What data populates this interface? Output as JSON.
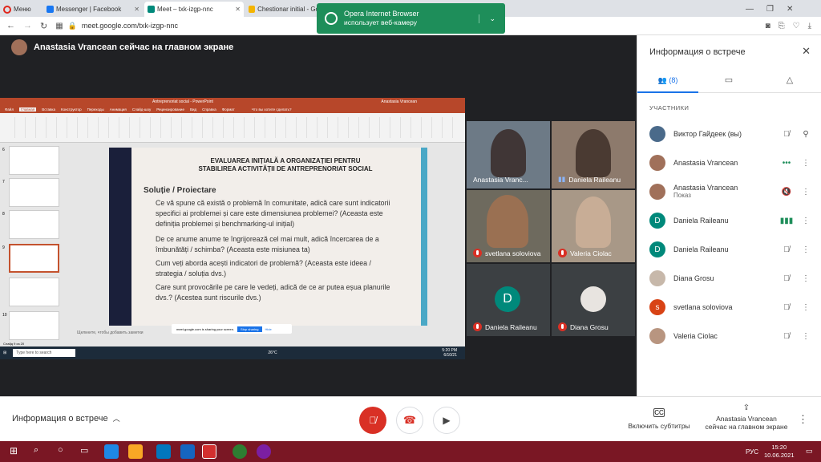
{
  "browser": {
    "menu_label": "Меню",
    "tabs": [
      {
        "label": "Messenger | Facebook",
        "color": "#1877f2"
      },
      {
        "label": "Meet – txk-izgp-nnc",
        "color": "#00897b"
      },
      {
        "label": "Chestionar initial - Go",
        "color": "#f4b400"
      }
    ],
    "url": "meet.google.com/txk-izgp-nnc"
  },
  "toast": {
    "title": "Opera Internet Browser",
    "subtitle": "использует веб-камеру"
  },
  "meet": {
    "presenter_banner": "Anastasia Vrancean сейчас на главном экране",
    "tiles": [
      {
        "name": "Anastasia Vranc...",
        "muted": false,
        "bg": "#6d7a86"
      },
      {
        "name": "Daniela Raileanu",
        "muted": false,
        "bg": "#8d7a6c"
      },
      {
        "name": "svetlana soloviova",
        "muted": true,
        "bg": "#6e6a5e"
      },
      {
        "name": "Valeria Ciolac",
        "muted": true,
        "bg": "#a89887"
      },
      {
        "name": "Daniela Raileanu",
        "muted": true,
        "initial": "D",
        "avatar_color": "#00897b"
      },
      {
        "name": "Diana Grosu",
        "muted": true,
        "avatar_color": "#e8e4e0"
      }
    ]
  },
  "ppt": {
    "app_title": "Antreprenoriat social - PowerPoint",
    "user": "Anastasia Vrancean",
    "tabs": [
      "Файл",
      "Главная",
      "Вставка",
      "Конструктор",
      "Переходы",
      "Анимация",
      "Слайд-шоу",
      "Рецензирование",
      "Вид",
      "Справка",
      "Формат"
    ],
    "tell_me": "Что вы хотите сделать?",
    "slide_title_line1": "EVALUAREA INIȚIALĂ A ORGANIZAȚIEI PENTRU",
    "slide_title_line2": "STABILIREA ACTIVITĂȚII DE ANTREPRENORIAT SOCIAL",
    "subtitle": "Soluție / Proiectare",
    "bullets": [
      "Ce vă spune că există o problemă în comunitate, adică care sunt indicatorii specifici ai problemei și care este dimensiunea problemei? (Aceasta este definiția problemei și benchmarking-ul inițial)",
      "De ce anume anume te îngrijorează cel mai mult, adică încercarea de a îmbunătăți / schimba? (Aceasta este misiunea ta)",
      "Cum veți aborda acești indicatori de problemă? (Aceasta este ideea / strategia / soluția dvs.)",
      "Care sunt provocările pe care le vedeți, adică de ce ar putea eșua planurile dvs.? (Acestea sunt riscurile dvs.)"
    ],
    "notes": "Щелкните, чтобы добавить заметки",
    "sharing_text": "meet.google.com is sharing your screen.",
    "stop_sharing": "Stop sharing",
    "hide": "Hide",
    "status_left": "Слайд 9 из 20",
    "win_search": "Type here to search",
    "win_temp": "26°C",
    "win_time": "5:20 PM",
    "win_date": "6/10/21",
    "thumb_numbers": [
      "6",
      "7",
      "8",
      "9",
      "10"
    ]
  },
  "panel": {
    "title": "Информация о встрече",
    "people_count": "(8)",
    "section": "УЧАСТНИКИ",
    "participants": [
      {
        "name": "Виктор Гайдеек (вы)",
        "sub": "",
        "color": "#4a6a8a",
        "initial": ""
      },
      {
        "name": "Anastasia Vrancean",
        "sub": "",
        "color": "#a0705a",
        "initial": ""
      },
      {
        "name": "Anastasia Vrancean",
        "sub": "Показ",
        "color": "#a0705a",
        "initial": ""
      },
      {
        "name": "Daniela Raileanu",
        "sub": "",
        "color": "#00897b",
        "initial": "D"
      },
      {
        "name": "Daniela Raileanu",
        "sub": "",
        "color": "#00897b",
        "initial": "D"
      },
      {
        "name": "Diana Grosu",
        "sub": "",
        "color": "#c7b8aa",
        "initial": ""
      },
      {
        "name": "svetlana soloviova",
        "sub": "",
        "color": "#d84315",
        "initial": "s"
      },
      {
        "name": "Valeria Ciolac",
        "sub": "",
        "color": "#b89580",
        "initial": ""
      }
    ]
  },
  "bottom": {
    "meeting_info": "Информация о встрече",
    "captions": "Включить субтитры",
    "presenter": "Anastasia Vrancean",
    "presenter_sub": "сейчас на главном экране"
  },
  "taskbar": {
    "lang": "РУС",
    "time": "15:20",
    "date": "10.06.2021"
  }
}
